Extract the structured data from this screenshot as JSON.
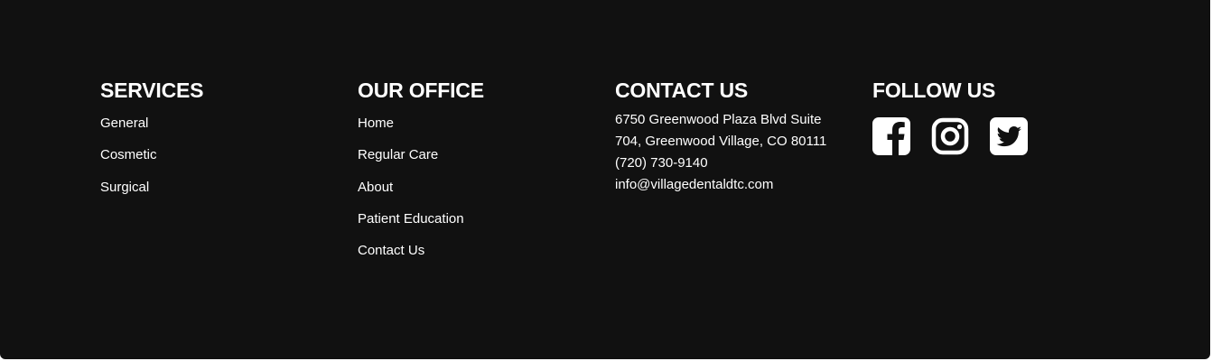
{
  "services": {
    "heading": "SERVICES",
    "links": [
      "General",
      "Cosmetic",
      "Surgical"
    ]
  },
  "office": {
    "heading": "OUR OFFICE",
    "links": [
      "Home",
      "Regular Care",
      "About",
      "Patient Education",
      "Contact Us"
    ]
  },
  "contact": {
    "heading": "CONTACT US",
    "address_line1": "6750 Greenwood Plaza Blvd Suite",
    "address_line2": "704, Greenwood Village, CO 80111",
    "phone": "(720) 730-9140",
    "email": "info@villagedentaldtc.com"
  },
  "follow": {
    "heading": "FOLLOW US",
    "icons": [
      "facebook-icon",
      "instagram-icon",
      "twitter-icon"
    ]
  },
  "colors": {
    "background": "#111111",
    "text": "#ffffff"
  }
}
